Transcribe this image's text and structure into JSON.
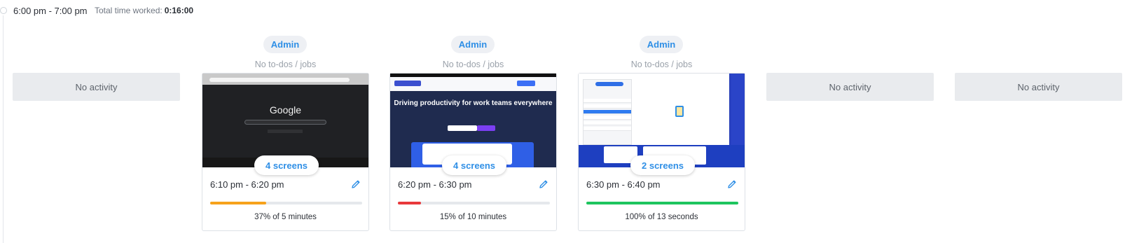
{
  "header": {
    "hour_range": "6:00 pm - 7:00 pm",
    "total_label": "Total time worked:",
    "total_value": "0:16:00"
  },
  "slots": [
    {
      "type": "empty",
      "label": "No activity"
    },
    {
      "type": "activity",
      "user": "Admin",
      "todo": "No to-dos / jobs",
      "thumbnail": "google-search-screenshot",
      "screens_label": "4 screens",
      "time_range": "6:10 pm - 6:20 pm",
      "activity_percent": 37,
      "activity_text": "37% of 5 minutes",
      "bar_color": "#f6a21b"
    },
    {
      "type": "activity",
      "user": "Admin",
      "todo": "No to-dos / jobs",
      "thumbnail": "hubstaff-homepage-screenshot",
      "thumb_headline": "Driving productivity for work teams everywhere",
      "screens_label": "4 screens",
      "time_range": "6:20 pm - 6:30 pm",
      "activity_percent": 15,
      "activity_text": "15% of 10 minutes",
      "bar_color": "#e8383b"
    },
    {
      "type": "activity",
      "user": "Admin",
      "todo": "No to-dos / jobs",
      "thumbnail": "tasks-app-screenshot",
      "screens_label": "2 screens",
      "time_range": "6:30 pm - 6:40 pm",
      "activity_percent": 100,
      "activity_text": "100% of 13 seconds",
      "bar_color": "#1ec55e"
    },
    {
      "type": "empty",
      "label": "No activity"
    },
    {
      "type": "empty",
      "label": "No activity"
    }
  ],
  "thumb_google_logo": "Google",
  "colors": {
    "accent": "#2f8fe6",
    "empty_bg": "#e9ebee",
    "track": "#e5e8ec"
  }
}
